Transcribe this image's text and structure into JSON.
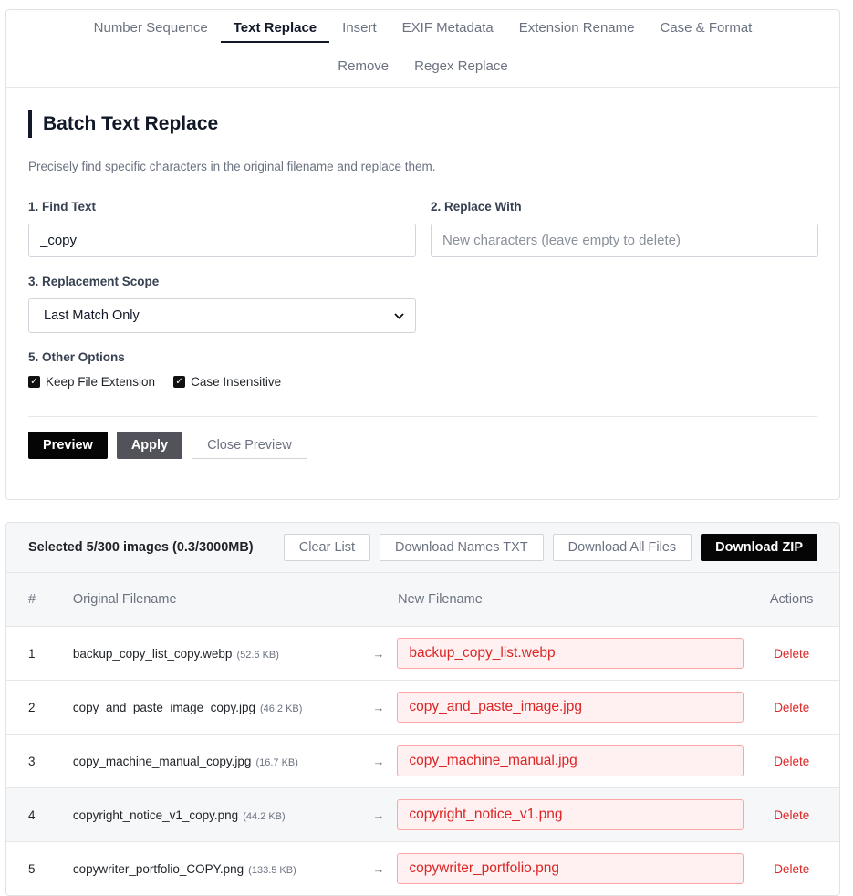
{
  "tabs": {
    "row1": [
      "Number Sequence",
      "Text Replace",
      "Insert",
      "EXIF Metadata",
      "Extension Rename",
      "Case & Format"
    ],
    "row2": [
      "Remove",
      "Regex Replace"
    ],
    "active": "Text Replace"
  },
  "panel": {
    "title": "Batch Text Replace",
    "description": "Precisely find specific characters in the original filename and replace them.",
    "find": {
      "label": "1. Find Text",
      "value": "_copy"
    },
    "replace": {
      "label": "2. Replace With",
      "value": "",
      "placeholder": "New characters (leave empty to delete)"
    },
    "scope": {
      "label": "3. Replacement Scope",
      "selected": "Last Match Only"
    },
    "options": {
      "label": "5. Other Options",
      "keep_extension": {
        "label": "Keep File Extension",
        "checked": true
      },
      "case_insensitive": {
        "label": "Case Insensitive",
        "checked": true
      }
    },
    "buttons": {
      "preview": "Preview",
      "apply": "Apply",
      "close_preview": "Close Preview"
    }
  },
  "list": {
    "selected_text": "Selected 5/300 images (0.3/3000MB)",
    "buttons": {
      "clear": "Clear List",
      "download_names": "Download Names TXT",
      "download_all": "Download All Files",
      "download_zip": "Download ZIP"
    },
    "headers": {
      "num": "#",
      "original": "Original Filename",
      "new": "New Filename",
      "actions": "Actions"
    },
    "arrow": "→",
    "delete_label": "Delete",
    "rows": [
      {
        "num": "1",
        "original": "backup_copy_list_copy.webp",
        "size": "(52.6 KB)",
        "new": "backup_copy_list.webp"
      },
      {
        "num": "2",
        "original": "copy_and_paste_image_copy.jpg",
        "size": "(46.2 KB)",
        "new": "copy_and_paste_image.jpg"
      },
      {
        "num": "3",
        "original": "copy_machine_manual_copy.jpg",
        "size": "(16.7 KB)",
        "new": "copy_machine_manual.jpg"
      },
      {
        "num": "4",
        "original": "copyright_notice_v1_copy.png",
        "size": "(44.2 KB)",
        "new": "copyright_notice_v1.png"
      },
      {
        "num": "5",
        "original": "copywriter_portfolio_COPY.png",
        "size": "(133.5 KB)",
        "new": "copywriter_portfolio.png"
      }
    ]
  },
  "colors": {
    "accent": "#050505",
    "danger": "#dc2626",
    "danger_bg": "#fff1f2"
  }
}
